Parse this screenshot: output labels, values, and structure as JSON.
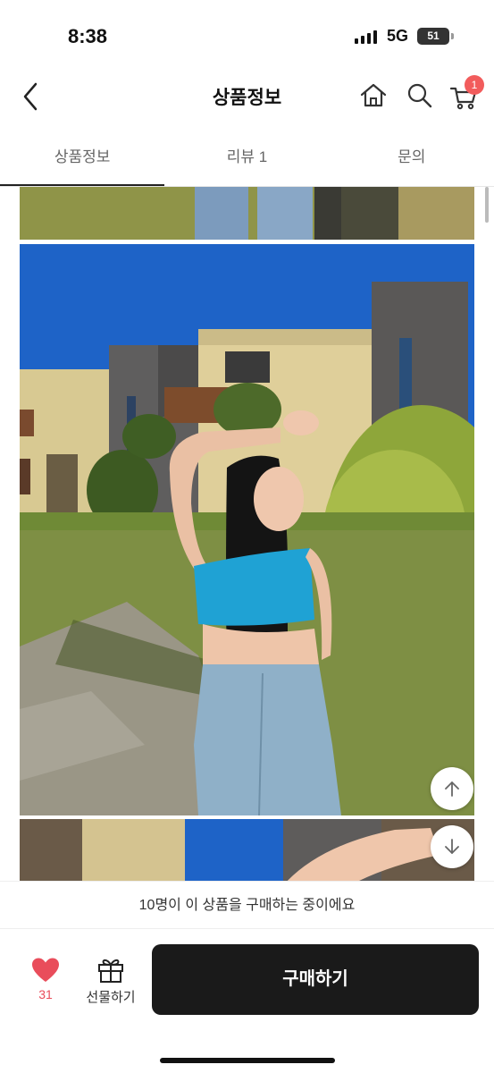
{
  "status_bar": {
    "time": "8:38",
    "network": "5G",
    "battery": "51"
  },
  "header": {
    "title": "상품정보",
    "cart_count": "1"
  },
  "tabs": [
    {
      "label": "상품정보",
      "active": true
    },
    {
      "label": "리뷰 1",
      "active": false
    },
    {
      "label": "문의",
      "active": false
    }
  ],
  "notice": {
    "text": "10명이 이 상품을 구매하는 중이에요"
  },
  "bottom_bar": {
    "like_count": "31",
    "gift_label": "선물하기",
    "buy_label": "구매하기"
  },
  "colors": {
    "accent": "#e94d5b",
    "badge": "#f25c5c",
    "buy_button": "#1a1a1a"
  },
  "icons": [
    "back-icon",
    "home-icon",
    "search-icon",
    "cart-icon",
    "heart-icon",
    "gift-icon",
    "arrow-up-icon",
    "arrow-down-icon"
  ]
}
